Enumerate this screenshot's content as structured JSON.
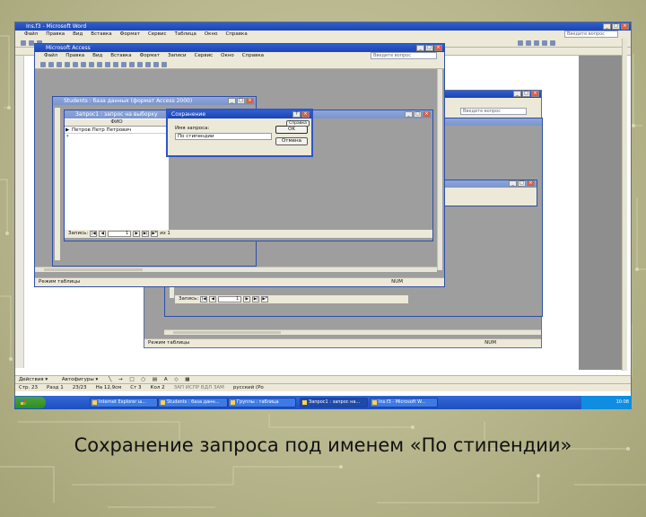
{
  "word": {
    "title": "Ins.f3 - Microsoft Word",
    "menu": [
      "Файл",
      "Правка",
      "Вид",
      "Вставка",
      "Формат",
      "Сервис",
      "Таблица",
      "Окно",
      "Справка"
    ],
    "help_placeholder": "Введите вопрос",
    "drawing_label": "Действия",
    "autoshapes_label": "Автофигуры",
    "status": {
      "page": "Стр. 23",
      "section": "Разд 1",
      "pages": "23/23",
      "at": "На 12,9см",
      "line": "Ст 3",
      "col": "Кол 2",
      "modes": "ЗАП ИСПР ВДЛ ЗАМ",
      "lang": "русский (Ро"
    }
  },
  "access": {
    "title": "Microsoft Access",
    "menu": [
      "Файл",
      "Правка",
      "Вид",
      "Вставка",
      "Формат",
      "Записи",
      "Сервис",
      "Окно",
      "Справка"
    ],
    "help_placeholder": "Введите вопрос",
    "status_left": "Режим таблицы",
    "status_right": "NUM"
  },
  "db_window": {
    "title": "Students : база данных (формат Access 2000)"
  },
  "query_window": {
    "title": "Запрос1 : запрос на выборку",
    "column_header": "ФИО",
    "rows": [
      "Петров Петр Петрович"
    ],
    "nav": {
      "label": "Запись:",
      "current": "1",
      "total": "из 1"
    }
  },
  "save_dialog": {
    "title": "Сохранение",
    "field_label": "Имя запроса:",
    "field_value": "По стипендии",
    "ok": "OK",
    "cancel": "Отмена",
    "help": "Справка"
  },
  "bg_access": {
    "help_placeholder": "Введите вопрос",
    "nav": {
      "label": "Запись:",
      "current": "1"
    },
    "status_left": "Режим таблицы",
    "status_right": "NUM"
  },
  "taskbar": {
    "start": "пуск",
    "tasks": [
      "Internet Explorer ш...",
      "Students : база данн...",
      "Группы : таблица",
      "Запрос1 : запрос на...",
      "Ins.f3 - Microsoft W..."
    ],
    "clock": "10:08"
  },
  "caption": "Сохранение запроса под именем «По стипендии»"
}
